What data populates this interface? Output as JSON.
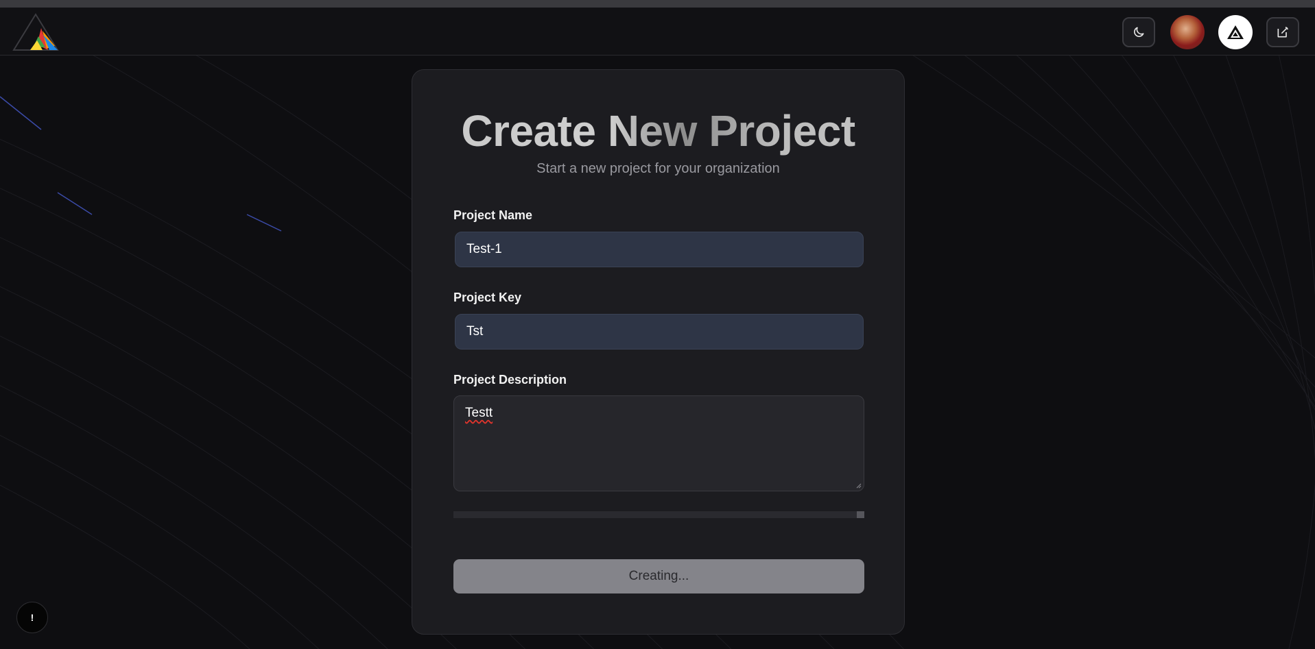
{
  "header": {
    "theme_toggle_icon": "moon-icon",
    "avatar_icon": "user-avatar",
    "brand_icon": "prism-logo-icon",
    "edit_icon": "edit-note-icon"
  },
  "form": {
    "title": "Create New Project",
    "subtitle": "Start a new project for your organization",
    "name_label": "Project Name",
    "name_value": "Test-1",
    "key_label": "Project Key",
    "key_value": "Tst",
    "description_label": "Project Description",
    "description_value": "Testt",
    "progress": 1.0,
    "submit_label": "Creating..."
  },
  "help": {
    "label": "!"
  },
  "colors": {
    "background": "#0e0e11",
    "card": "#1c1c20",
    "input": "#2e3546",
    "button_disabled": "#84848a"
  }
}
